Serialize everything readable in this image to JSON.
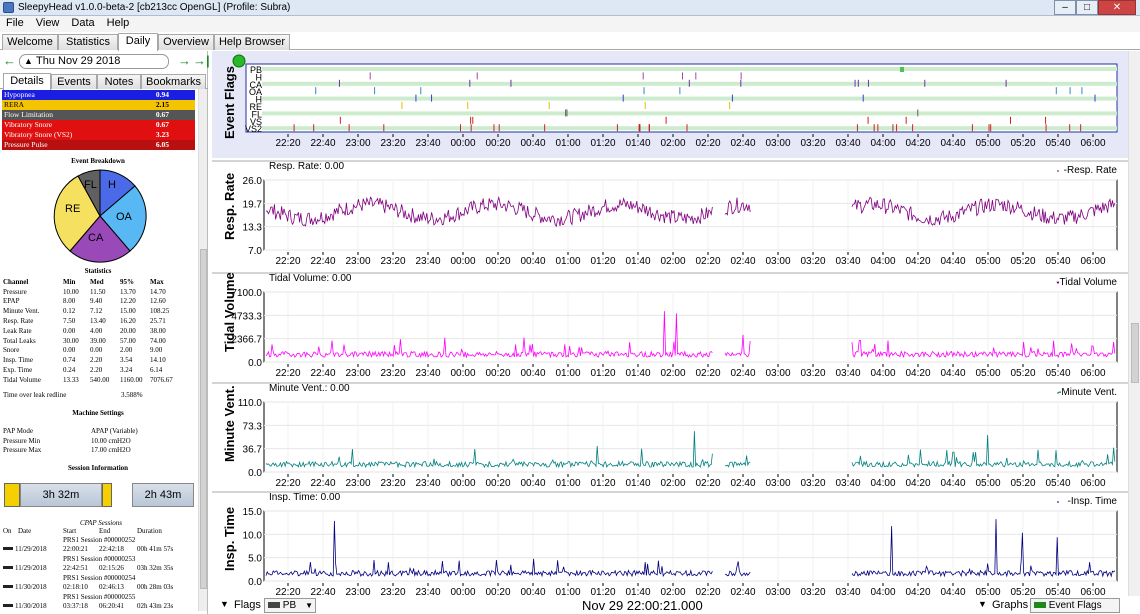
{
  "window": {
    "title": "SleepyHead v1.0.0-beta-2 [cb213cc OpenGL] (Profile: Subra)",
    "min": "–",
    "max": "□",
    "close": "✕"
  },
  "menu": [
    "File",
    "View",
    "Data",
    "Help"
  ],
  "main_tabs": [
    "Welcome",
    "Statistics",
    "Daily",
    "Overview",
    "Help Browser"
  ],
  "active_tab": "Daily",
  "date_nav": {
    "date": "Thu Nov 29 2018",
    "prev": "←",
    "next": "→",
    "jump": "→|",
    "up": "▲"
  },
  "detail_tabs": [
    "Details",
    "Events",
    "Notes",
    "Bookmarks"
  ],
  "event_summary": [
    {
      "name": "Hypopnea",
      "value": "0.94",
      "color": "#1a1ee0"
    },
    {
      "name": "RERA",
      "value": "2.15",
      "color": "#f5c400"
    },
    {
      "name": "Flow Limitation",
      "value": "0.67",
      "color": "#555555"
    },
    {
      "name": "Vibratory Snore",
      "value": "0.67",
      "color": "#e01010"
    },
    {
      "name": "Vibratory Snore (VS2)",
      "value": "3.23",
      "color": "#e01010"
    },
    {
      "name": "Pressure Pulse",
      "value": "6.05",
      "color": "#b81010"
    }
  ],
  "breakdown_title": "Event Breakdown",
  "pie": {
    "slices": [
      {
        "label": "H",
        "color": "#4a6ae8"
      },
      {
        "label": "OA",
        "color": "#58b8f4"
      },
      {
        "label": "CA",
        "color": "#9a4ab8"
      },
      {
        "label": "RE",
        "color": "#f5e060"
      },
      {
        "label": "FL",
        "color": "#606060"
      }
    ]
  },
  "statistics": {
    "title": "Statistics",
    "headers": [
      "Channel",
      "Min",
      "Med",
      "95%",
      "Max"
    ],
    "rows": [
      [
        "Pressure",
        "10.00",
        "11.50",
        "13.70",
        "14.70"
      ],
      [
        "EPAP",
        "8.00",
        "9.40",
        "12.20",
        "12.60"
      ],
      [
        "Minute Vent.",
        "0.12",
        "7.12",
        "15.00",
        "108.25"
      ],
      [
        "Resp. Rate",
        "7.50",
        "13.40",
        "16.20",
        "25.71"
      ],
      [
        "Leak Rate",
        "0.00",
        "4.00",
        "20.00",
        "38.00"
      ],
      [
        "Total Leaks",
        "30.00",
        "39.00",
        "57.00",
        "74.00"
      ],
      [
        "Snore",
        "0.00",
        "0.00",
        "2.00",
        "9.00"
      ],
      [
        "Insp. Time",
        "0.74",
        "2.20",
        "3.54",
        "14.10"
      ],
      [
        "Exp. Time",
        "0.24",
        "2.20",
        "3.24",
        "6.14"
      ],
      [
        "Tidal Volume",
        "13.33",
        "540.00",
        "1160.00",
        "7076.67"
      ]
    ],
    "leak_label": "Time over leak redline",
    "leak_value": "3.588%"
  },
  "machine": {
    "title": "Machine Settings",
    "rows": [
      [
        "PAP Mode",
        "APAP (Variable)"
      ],
      [
        "Pressure Min",
        "10.00 cmH2O"
      ],
      [
        "Pressure Max",
        "17.00 cmH2O"
      ]
    ]
  },
  "session_info": {
    "title": "Session Information",
    "durations": [
      "3h 32m",
      "2h 43m"
    ]
  },
  "cpap_sessions": {
    "title": "CPAP Sessions",
    "headers": [
      "On",
      "Date",
      "Start",
      "End",
      "Duration"
    ],
    "rows": [
      {
        "id": "PRS1 Session #00000252",
        "date": "11/29/2018",
        "start": "22:00:21",
        "end": "22:42:18",
        "dur": "00h 41m 57s"
      },
      {
        "id": "PRS1 Session #00000253",
        "date": "11/29/2018",
        "start": "22:42:51",
        "end": "02:15:26",
        "dur": "03h 32m 35s"
      },
      {
        "id": "PRS1 Session #00000254",
        "date": "11/30/2018",
        "start": "02:18:10",
        "end": "02:46:13",
        "dur": "00h 28m 03s"
      },
      {
        "id": "PRS1 Session #00000255",
        "date": "11/30/2018",
        "start": "03:37:18",
        "end": "06:20:41",
        "dur": "02h 43m 23s"
      }
    ]
  },
  "time_axis": [
    "22:20",
    "22:40",
    "23:00",
    "23:20",
    "23:40",
    "00:00",
    "00:20",
    "00:40",
    "01:00",
    "01:20",
    "01:40",
    "02:00",
    "02:20",
    "02:40",
    "03:00",
    "03:20",
    "03:40",
    "04:00",
    "04:20",
    "04:40",
    "05:00",
    "05:20",
    "05:40",
    "06:00"
  ],
  "flags": {
    "ylabel": "Event Flags",
    "channels": [
      "PB",
      "H",
      "CA",
      "OA",
      "H",
      "RE",
      "FL",
      "VS",
      "VS2"
    ]
  },
  "graphs": [
    {
      "ylabel": "Resp. Rate",
      "header": "Resp. Rate: 0.00",
      "legend": "Resp. Rate",
      "ticks": [
        "26.0",
        "19.7",
        "13.3",
        "7.0"
      ],
      "color": "#800080"
    },
    {
      "ylabel": "Tidal Volume",
      "header": "Tidal Volume: 0.00",
      "legend": "Tidal Volume",
      "ticks": [
        "7100.0",
        "4733.3",
        "2366.7",
        "0.0"
      ],
      "color": "#ff00ff"
    },
    {
      "ylabel": "Minute Vent.",
      "header": "Minute Vent.: 0.00",
      "legend": "Minute Vent.",
      "ticks": [
        "110.0",
        "73.3",
        "36.7",
        "0.0"
      ],
      "color": "#008080"
    },
    {
      "ylabel": "Insp. Time",
      "header": "Insp. Time: 0.00",
      "legend": "Insp. Time",
      "ticks": [
        "15.0",
        "10.0",
        "5.0",
        "0.0"
      ],
      "color": "#000080"
    }
  ],
  "bottom": {
    "flags_label": "Flags",
    "flags_select": "PB",
    "timestamp": "Nov 29 22:00:21.000",
    "graphs_label": "Graphs",
    "event_flags": "Event Flags"
  }
}
